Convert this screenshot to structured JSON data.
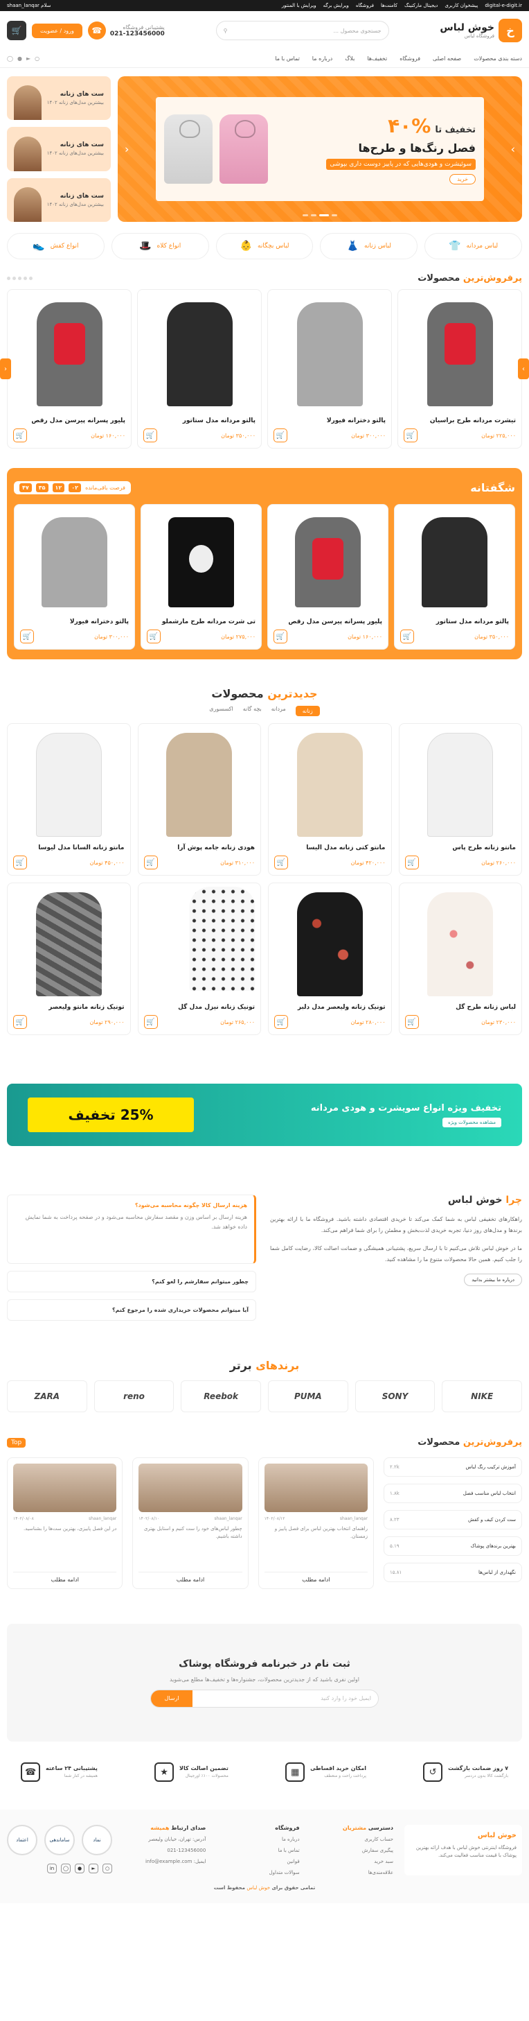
{
  "topbar": {
    "right": [
      "digital-e-digit.ir",
      "پیشخوان کاربری",
      "دیجیتال مارکتینگ",
      "کامنت‌ها",
      "فروشگاه",
      "ویرایش برگه",
      "ویرایش با المنتور"
    ],
    "left": "سلام shaan_lanqar"
  },
  "header": {
    "logo_mark": "خ",
    "logo_title": "خوش لباس",
    "logo_sub": "فروشگاه لباس",
    "search_placeholder": "جستجوی محصول ...",
    "phone_label": "پشتیبانی فروشگاه",
    "phone": "021-123456000",
    "login": "ورود / عضویت"
  },
  "nav": {
    "items": [
      "دسته بندی محصولات",
      "صفحه اصلی",
      "فروشگاه",
      "تخفیف‌ها",
      "بلاگ",
      "درباره ما",
      "تماس با ما"
    ]
  },
  "hero": {
    "t1": "تخفیف تا",
    "pct": "۴۰%",
    "t2": "فصل رنگ‌ها و طرح‌ها",
    "t3": "سوئیشرت و هودی‌هایی که در پاییز دوست داری بپوشی",
    "cta": "خرید"
  },
  "side_cards": [
    {
      "title": "ست های زنانه",
      "sub": "بیشترین مدل‌های زنانه ۱۴۰۲"
    },
    {
      "title": "ست های زنانه",
      "sub": "بیشترین مدل‌های زنانه ۱۴۰۲"
    },
    {
      "title": "ست های زنانه",
      "sub": "بیشترین مدل‌های زنانه ۱۴۰۲"
    }
  ],
  "categories": [
    "لباس مردانه",
    "لباس زنانه",
    "لباس بچگانه",
    "انواع کلاه",
    "انواع کفش"
  ],
  "bestsellers": {
    "title_a": "پرفروش‌ترین",
    "title_b": " محصولات",
    "items": [
      {
        "name": "تیشرت مردانه طرح براسیان",
        "price": "۲۲۵,۰۰۰ تومان"
      },
      {
        "name": "پالتو دخترانه فیورلا",
        "price": "۳۰۰,۰۰۰ تومان"
      },
      {
        "name": "پالتو مردانه مدل ستاتور",
        "price": "۳۵۰,۰۰۰ تومان"
      },
      {
        "name": "پلیور پسرانه پیرسن مدل رقص",
        "price": "۱۶۰,۰۰۰ تومان"
      }
    ]
  },
  "amazing": {
    "title": "شگفتانه",
    "timer_label": "فرصت باقی‌مانده",
    "timer": [
      "۰۲",
      "۱۲",
      "۳۵",
      "۴۷"
    ],
    "items": [
      {
        "name": "پالتو مردانه مدل ستاتور",
        "price": "۳۵۰,۰۰۰ تومان"
      },
      {
        "name": "پلیور پسرانه پیرسن مدل رقص",
        "price": "۱۶۰,۰۰۰ تومان"
      },
      {
        "name": "تی شرت مردانه طرح مارشملو",
        "price": "۲۷۵,۰۰۰ تومان"
      },
      {
        "name": "پالتو دخترانه فیورلا",
        "price": "۳۰۰,۰۰۰ تومان"
      }
    ]
  },
  "newest": {
    "title_a": "جدیدترین ",
    "title_b": "محصولات",
    "tabs": [
      "زنانه",
      "مردانه",
      "بچه گانه",
      "اکسسوری"
    ],
    "items": [
      {
        "name": "مانتو زنانه طرح پاس",
        "price": "۲۶۰,۰۰۰ تومان"
      },
      {
        "name": "مانتو کتی زنانه مدل الیسا",
        "price": "۴۲۰,۰۰۰ تومان"
      },
      {
        "name": "هودی زنانه جامه پوش آرا",
        "price": "۳۱۰,۰۰۰ تومان"
      },
      {
        "name": "مانتو زنانه السانا مدل لیوسا",
        "price": "۴۵۰,۰۰۰ تومان"
      },
      {
        "name": "لباس زنانه طرح گل",
        "price": "۲۳۰,۰۰۰ تومان"
      },
      {
        "name": "تونیک زنانه ولیعصر مدل دلبر",
        "price": "۲۸۰,۰۰۰ تومان"
      },
      {
        "name": "تونیک زنانه نیزل مدل گل",
        "price": "۲۶۵,۰۰۰ تومان"
      },
      {
        "name": "تونیک زنانه مانتو ولیعصر",
        "price": "۲۹۰,۰۰۰ تومان"
      }
    ]
  },
  "banner": {
    "title": "تخفیف ویژه انواع سویشرت و هودی مردانه",
    "btn": "مشاهده محصولات ویژه",
    "badge": "25% تخفیف"
  },
  "why": {
    "title_a": "چرا ",
    "title_b": "خوش لباس",
    "p1": "راهکارهای تخفیفی لباس به شما کمک می‌کند تا خریدی اقتصادی داشته باشید. فروشگاه ما با ارائه بهترین برندها و مدل‌های روز دنیا، تجربه خریدی لذت‌بخش و مطمئن را برای شما فراهم می‌کند.",
    "p2": "ما در خوش لباس تلاش می‌کنیم تا با ارسال سریع، پشتیبانی همیشگی و ضمانت اصالت کالا، رضایت کامل شما را جلب کنیم. همین حالا محصولات متنوع ما را مشاهده کنید.",
    "btn": "درباره ما بیشتر بدانید",
    "faq": [
      {
        "q": "هزینه ارسال کالا چگونه محاسبه می‌شود؟",
        "a": "هزینه ارسال بر اساس وزن و مقصد سفارش محاسبه می‌شود و در صفحه پرداخت به شما نمایش داده خواهد شد."
      },
      {
        "q": "چطور میتوانم سفارشم را لغو کنم؟"
      },
      {
        "q": "آیا میتوانم محصولات خریداری شده را مرجوع کنم؟"
      }
    ]
  },
  "brands": {
    "title_a": "برندهای ",
    "title_b": "برتر",
    "items": [
      "NIKE",
      "SONY",
      "PUMA",
      "Reebok",
      "reno",
      "ZARA"
    ]
  },
  "top_posts": {
    "tag": "Top",
    "title_a": "پرفروش‌ترین",
    "title_b": " محصولات",
    "list": [
      {
        "name": "آموزش ترکیب رنگ لباس",
        "num": "۲.۲k"
      },
      {
        "name": "انتخاب لباس مناسب فصل",
        "num": "۱.۸k"
      },
      {
        "name": "ست کردن کیف و کفش",
        "num": "۸.۲۳"
      },
      {
        "name": "بهترین برندهای پوشاک",
        "num": "۵.۱۹"
      },
      {
        "name": "نگهداری از لباس‌ها",
        "num": "۱۵.۸۱"
      }
    ],
    "blogs": [
      {
        "author": "shaan_lanqar",
        "date": "۱۴۰۲/۰۸/۱۲",
        "text": "راهنمای انتخاب بهترین لباس برای فصل پاییز و زمستان.",
        "more": "ادامه مطلب"
      },
      {
        "author": "shaan_lanqar",
        "date": "۱۴۰۲/۰۸/۱۰",
        "text": "چطور لباس‌های خود را ست کنیم و استایل بهتری داشته باشیم.",
        "more": "ادامه مطلب"
      },
      {
        "author": "shaan_lanqar",
        "date": "۱۴۰۲/۰۸/۰۸",
        "text": "در این فصل پاییزی، بهترین ست‌ها را بشناسید.",
        "more": "ادامه مطلب"
      }
    ]
  },
  "newsletter": {
    "title": "ثبت نام در خبرنامه فروشگاه پوشاک",
    "sub": "اولین نفری باشید که از جدیدترین محصولات، جشنواره‌ها و تخفیف‌ها مطلع می‌شوید",
    "placeholder": "ایمیل خود را وارد کنید",
    "btn": "ارسال"
  },
  "features": [
    {
      "title": "۷ روز ضمانت بازگشت",
      "sub": "بازگشت کالا بدون دردسر"
    },
    {
      "title": "امکان خرید اقساطی",
      "sub": "پرداخت راحت و منعطف"
    },
    {
      "title": "تضمین اصالت کالا",
      "sub": "محصولات ۱۰۰٪ اورجینال"
    },
    {
      "title": "پشتیبانی ۲۴ ساعته",
      "sub": "همیشه در کنار شما"
    }
  ],
  "footer": {
    "about_title": "خوش لباس",
    "about": "فروشگاه اینترنتی خوش لباس با هدف ارائه بهترین پوشاک با قیمت مناسب فعالیت می‌کند.",
    "col1": {
      "title_a": "دسترسی ",
      "title_b": "مشتریان",
      "links": [
        "حساب کاربری",
        "پیگیری سفارش",
        "سبد خرید",
        "علاقه‌مندی‌ها"
      ]
    },
    "col2": {
      "title_a": "فروشگاه ",
      "title_b": "",
      "links": [
        "درباره ما",
        "تماس با ما",
        "قوانین",
        "سوالات متداول"
      ]
    },
    "col3": {
      "title_a": "صدای ارتباط ",
      "title_b": "همیشه",
      "links": [
        "آدرس: تهران، خیابان ولیعصر",
        "021-123456000",
        "ایمیل: info@example.com"
      ]
    },
    "badges": [
      "نماد",
      "ساماندهی",
      "اعتماد"
    ]
  },
  "copyright": {
    "text": "تمامی حقوق برای ",
    "brand": "خوش لباس",
    "rest": " محفوظ است"
  }
}
